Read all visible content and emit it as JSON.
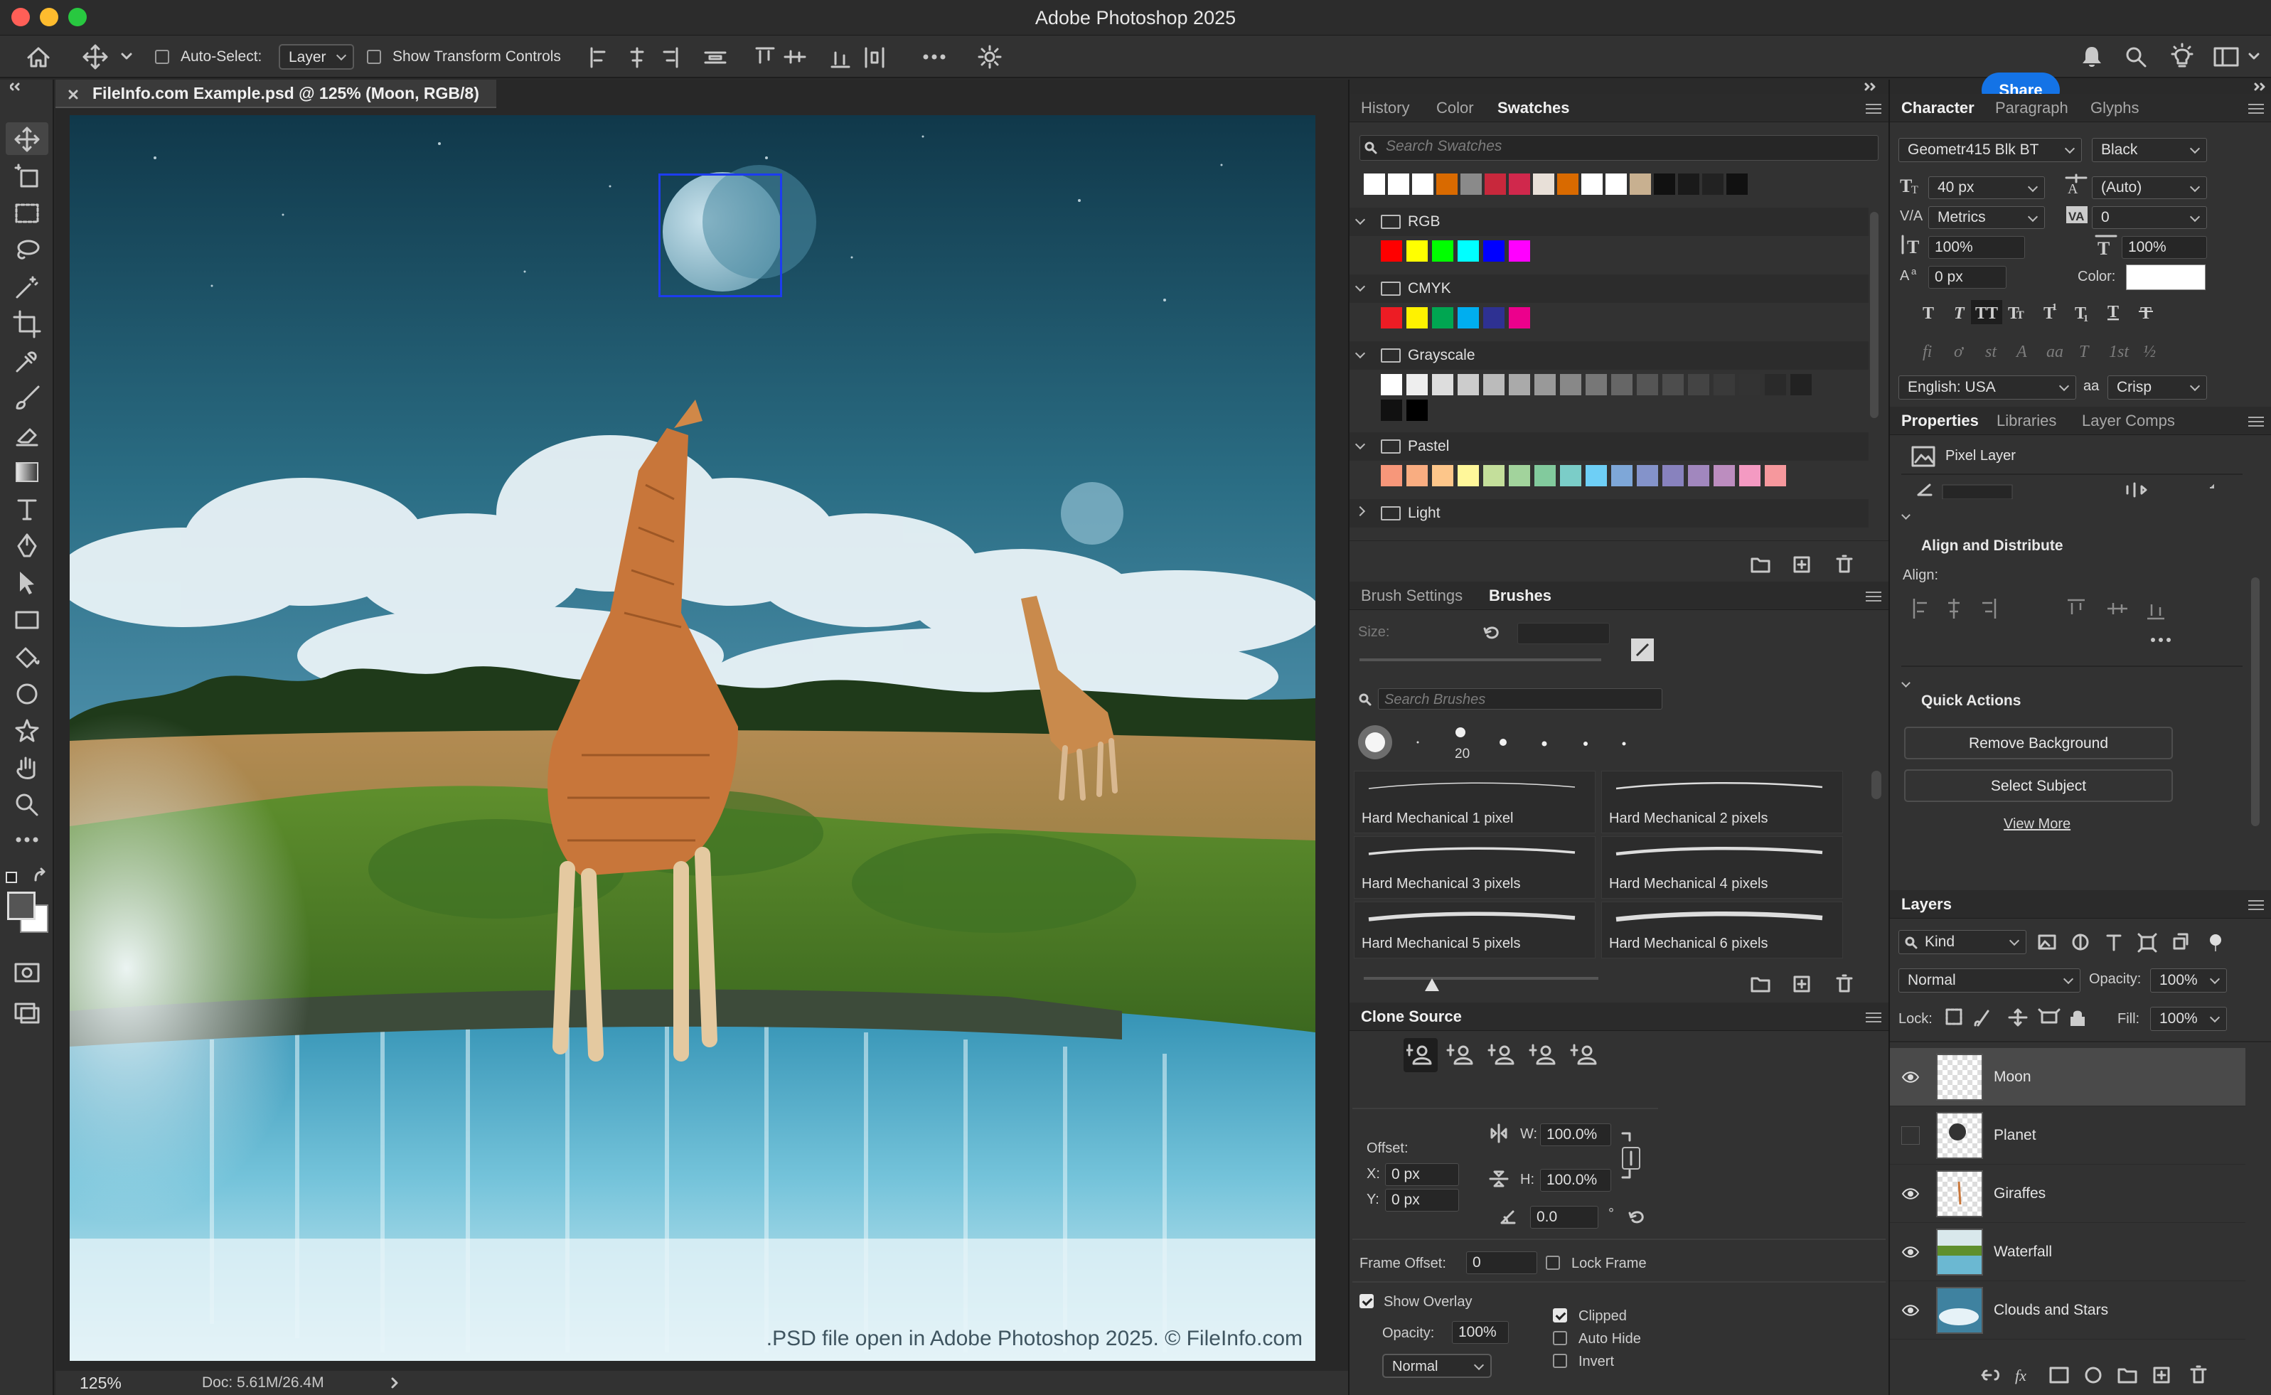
{
  "app_title": "Adobe Photoshop 2025",
  "options_bar": {
    "auto_select_label": "Auto-Select:",
    "auto_select_value": "Layer",
    "show_transform_label": "Show Transform Controls",
    "share_label": "Share"
  },
  "document": {
    "tab_title": "FileInfo.com Example.psd @ 125% (Moon, RGB/8)",
    "zoom": "125%",
    "doc_size": "Doc: 5.61M/26.4M",
    "watermark": ".PSD file open in Adobe Photoshop 2025. © FileInfo.com"
  },
  "swatches_panel": {
    "tabs": [
      "History",
      "Color",
      "Swatches"
    ],
    "search_placeholder": "Search Swatches",
    "recent_colors": [
      "#ffffff",
      "#ffffff",
      "#ffffff",
      "#d96a00",
      "#8a8a8a",
      "#c8283c",
      "#d0284c",
      "#e8e0d8",
      "#d96a00",
      "#ffffff",
      "#ffffff",
      "#c8b090",
      "#111111",
      "#1a1a1a",
      "#222222",
      "#111111"
    ],
    "groups": [
      {
        "name": "RGB",
        "colors": [
          "#ff0000",
          "#ffff00",
          "#00ff00",
          "#00ffff",
          "#0000ff",
          "#ff00ff"
        ]
      },
      {
        "name": "CMYK",
        "colors": [
          "#ed1c24",
          "#fff200",
          "#00a651",
          "#00aeef",
          "#2e3192",
          "#ec008c"
        ]
      },
      {
        "name": "Grayscale",
        "colors": [
          "#ffffff",
          "#eeeeee",
          "#dddddd",
          "#cccccc",
          "#bbbbbb",
          "#aaaaaa",
          "#999999",
          "#888888",
          "#777777",
          "#666666",
          "#555555",
          "#4d4d4d",
          "#444444",
          "#3a3a3a",
          "#333333",
          "#2a2a2a",
          "#222222",
          "#111111",
          "#000000"
        ]
      },
      {
        "name": "Pastel",
        "colors": [
          "#f7977a",
          "#f9ad81",
          "#fdc68a",
          "#fff79a",
          "#c4df9b",
          "#a2d39c",
          "#82ca9d",
          "#7bcdc8",
          "#6ecff6",
          "#7ea7d8",
          "#8493ca",
          "#8882be",
          "#a187be",
          "#bc8dbf",
          "#f49ac2",
          "#f6989d"
        ]
      },
      {
        "name": "Light",
        "colors": []
      }
    ]
  },
  "brushes_panel": {
    "tabs": [
      "Brush Settings",
      "Brushes"
    ],
    "size_label": "Size:",
    "search_placeholder": "Search Brushes",
    "tip_size": "20",
    "brushes": [
      "Hard Mechanical 1 pixel",
      "Hard Mechanical 2 pixels",
      "Hard Mechanical 3 pixels",
      "Hard Mechanical 4 pixels",
      "Hard Mechanical 5 pixels",
      "Hard Mechanical 6 pixels"
    ]
  },
  "clone_source": {
    "title": "Clone Source",
    "offset_label": "Offset:",
    "x_label": "X:",
    "x_value": "0 px",
    "y_label": "Y:",
    "y_value": "0 px",
    "w_label": "W:",
    "w_value": "100.0%",
    "h_label": "H:",
    "h_value": "100.0%",
    "angle_value": "0.0",
    "degree": "°",
    "frame_offset_label": "Frame Offset:",
    "frame_offset_value": "0",
    "lock_frame_label": "Lock Frame",
    "show_overlay_label": "Show Overlay",
    "opacity_label": "Opacity:",
    "opacity_value": "100%",
    "blend_value": "Normal",
    "clipped_label": "Clipped",
    "auto_hide_label": "Auto Hide",
    "invert_label": "Invert"
  },
  "character_panel": {
    "tabs": [
      "Character",
      "Paragraph",
      "Glyphs"
    ],
    "font_family": "Geometr415 Blk BT",
    "font_style": "Black",
    "font_size": "40 px",
    "leading": "(Auto)",
    "kerning": "Metrics",
    "tracking": "0",
    "vertical_scale": "100%",
    "horizontal_scale": "100%",
    "baseline_shift": "0 px",
    "color_label": "Color:",
    "language": "English: USA",
    "aa_label": "aa",
    "antialias": "Crisp"
  },
  "properties_panel": {
    "tabs": [
      "Properties",
      "Libraries",
      "Layer Comps"
    ],
    "layer_type": "Pixel Layer",
    "align_title": "Align and Distribute",
    "align_label": "Align:",
    "quick_actions_title": "Quick Actions",
    "remove_bg": "Remove Background",
    "select_subject": "Select Subject",
    "view_more": "View More"
  },
  "layers_panel": {
    "title": "Layers",
    "filter_kind": "Kind",
    "blend_mode": "Normal",
    "opacity_label": "Opacity:",
    "opacity_value": "100%",
    "lock_label": "Lock:",
    "fill_label": "Fill:",
    "fill_value": "100%",
    "layers": [
      {
        "name": "Moon",
        "visible": true,
        "selected": true
      },
      {
        "name": "Planet",
        "visible": false,
        "selected": false
      },
      {
        "name": "Giraffes",
        "visible": true,
        "selected": false
      },
      {
        "name": "Waterfall",
        "visible": true,
        "selected": false
      },
      {
        "name": "Clouds and Stars",
        "visible": true,
        "selected": false
      }
    ]
  },
  "colors": {
    "accent": "#1473e6",
    "selection": "#1d3cf0",
    "panel_bg": "#323232"
  }
}
